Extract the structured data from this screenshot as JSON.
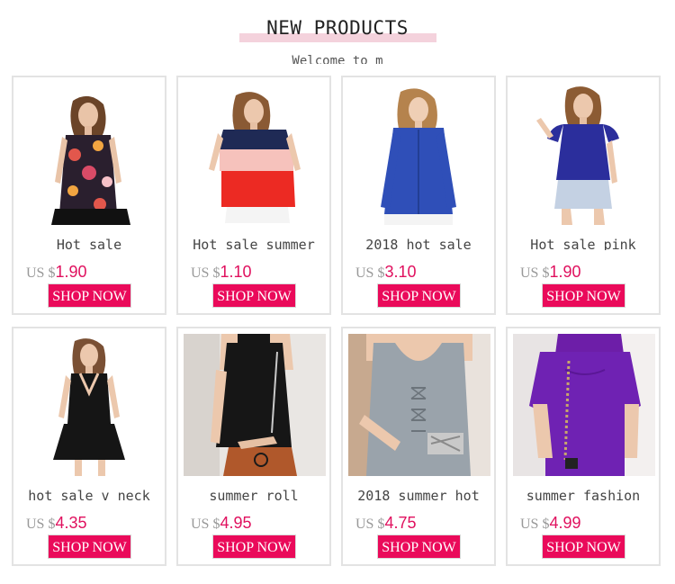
{
  "header": {
    "title": "NEW PRODUCTS",
    "subtitle": "Welcome to m"
  },
  "colors": {
    "accent": "#ea0a5a",
    "price": "#e0105e",
    "title_bar": "#f4d2dc"
  },
  "products": [
    {
      "name": "Hot sale",
      "currency": "US $",
      "price": "1.90",
      "button": "SHOP NOW",
      "photo": "floral-top-photo"
    },
    {
      "name": "Hot sale summer",
      "currency": "US $",
      "price": "1.10",
      "button": "SHOP NOW",
      "photo": "colorblock-tee-photo"
    },
    {
      "name": "2018 hot sale",
      "currency": "US $",
      "price": "3.10",
      "button": "SHOP NOW",
      "photo": "blue-shirt-photo"
    },
    {
      "name": "Hot sale pink",
      "currency": "US $",
      "price": "1.90",
      "button": "SHOP NOW",
      "photo": "blue-ruffle-top-photo"
    },
    {
      "name": "hot sale v neck",
      "currency": "US $",
      "price": "4.35",
      "button": "SHOP NOW",
      "photo": "black-dress-photo"
    },
    {
      "name": "summer roll",
      "currency": "US $",
      "price": "4.95",
      "button": "SHOP NOW",
      "photo": "black-knit-tank-photo"
    },
    {
      "name": "2018 summer hot",
      "currency": "US $",
      "price": "4.75",
      "button": "SHOP NOW",
      "photo": "grey-lace-tank-photo"
    },
    {
      "name": "summer fashion",
      "currency": "US $",
      "price": "4.99",
      "button": "SHOP NOW",
      "photo": "purple-knit-top-photo"
    }
  ]
}
